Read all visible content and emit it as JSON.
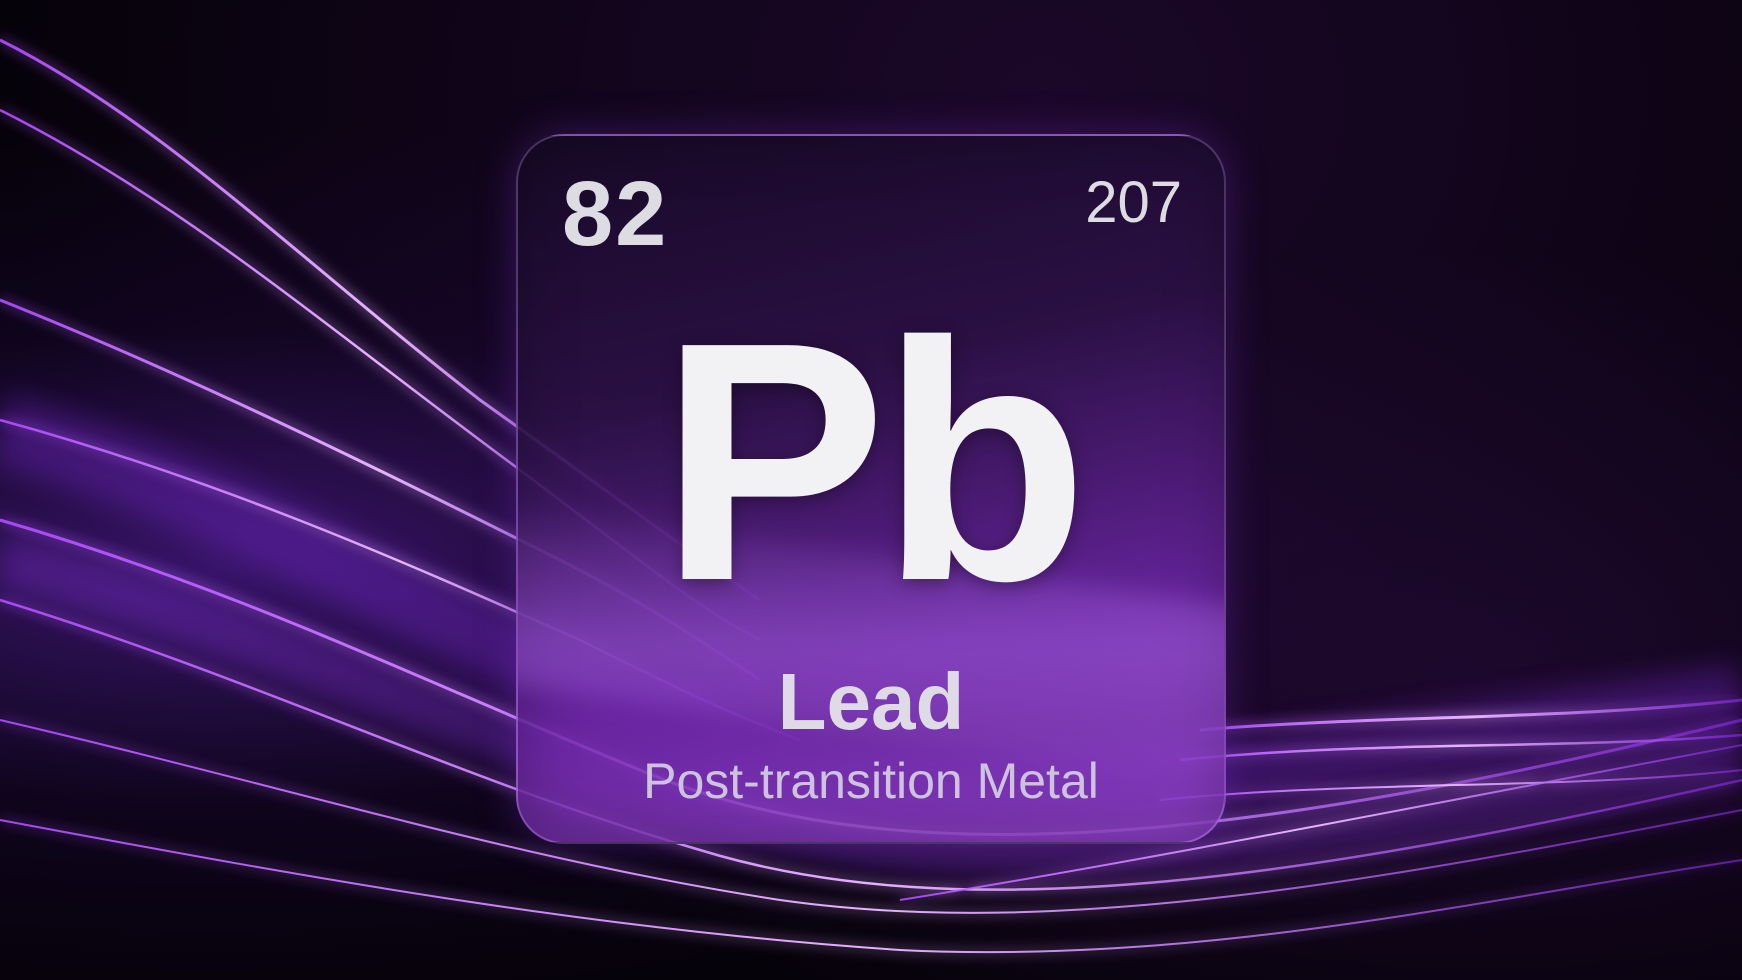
{
  "element": {
    "atomic_number": "82",
    "atomic_mass": "207",
    "symbol": "Pb",
    "name": "Lead",
    "category": "Post-transition Metal"
  },
  "colors": {
    "background": "#06030a",
    "accent_purple": "#9b3cf0",
    "glow_light": "#e7b3ff",
    "text_primary": "#f2f2f4",
    "text_secondary": "#cdc3de"
  }
}
